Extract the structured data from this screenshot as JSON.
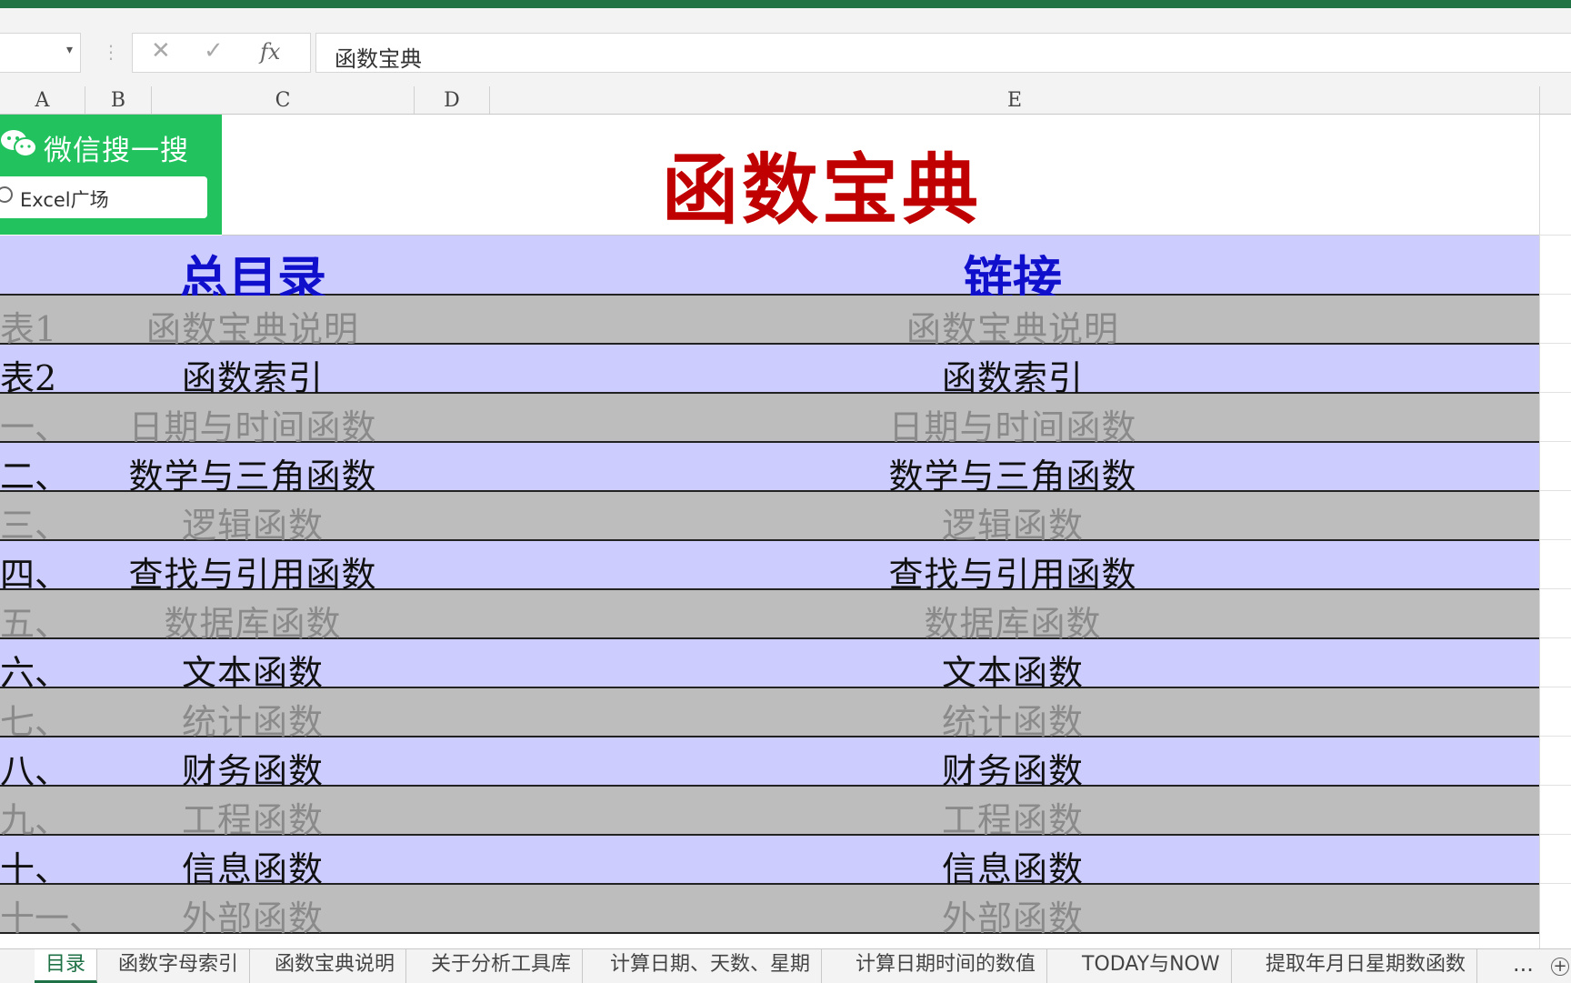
{
  "formula_bar": {
    "cancel_icon": "✕",
    "enter_icon": "✓",
    "fx_label": "fx",
    "content": "函数宝典"
  },
  "columns": [
    "A",
    "B",
    "C",
    "D",
    "E"
  ],
  "badge": {
    "title": "微信搜一搜",
    "search_text": "Excel广场",
    "color": "#22c35f"
  },
  "title": "函数宝典",
  "header": {
    "left": "总目录",
    "right": "链接"
  },
  "rows": [
    {
      "num": "表1",
      "name": "函数宝典说明",
      "link": "函数宝典说明",
      "style": "gray"
    },
    {
      "num": "表2",
      "name": "函数索引",
      "link": "函数索引",
      "style": "blue"
    },
    {
      "num": "一、",
      "name": "日期与时间函数",
      "link": "日期与时间函数",
      "style": "gray"
    },
    {
      "num": "二、",
      "name": "数学与三角函数",
      "link": "数学与三角函数",
      "style": "blue"
    },
    {
      "num": "三、",
      "name": "逻辑函数",
      "link": "逻辑函数",
      "style": "gray"
    },
    {
      "num": "四、",
      "name": "查找与引用函数",
      "link": "查找与引用函数",
      "style": "blue"
    },
    {
      "num": "五、",
      "name": "数据库函数",
      "link": "数据库函数",
      "style": "gray"
    },
    {
      "num": "六、",
      "name": "文本函数",
      "link": "文本函数",
      "style": "blue"
    },
    {
      "num": "七、",
      "name": "统计函数",
      "link": "统计函数",
      "style": "gray"
    },
    {
      "num": "八、",
      "name": "财务函数",
      "link": "财务函数",
      "style": "blue"
    },
    {
      "num": "九、",
      "name": "工程函数",
      "link": "工程函数",
      "style": "gray"
    },
    {
      "num": "十、",
      "name": "信息函数",
      "link": "信息函数",
      "style": "blue"
    },
    {
      "num": "十一、",
      "name": "外部函数",
      "link": "外部函数",
      "style": "gray"
    }
  ],
  "tabs": [
    {
      "label": "目录",
      "active": true
    },
    {
      "label": "函数字母索引"
    },
    {
      "label": "函数宝典说明"
    },
    {
      "label": "关于分析工具库"
    },
    {
      "label": "计算日期、天数、星期"
    },
    {
      "label": "计算日期时间的数值"
    },
    {
      "label": "TODAY与NOW"
    },
    {
      "label": "提取年月日星期数函数"
    }
  ],
  "tab_more": "...",
  "tab_add": "+",
  "colors": {
    "accent_green": "#217346",
    "title_red": "#c00000",
    "header_blue_text": "#1010cc",
    "row_blue": "#ccccff",
    "row_gray": "#bdbdbd"
  }
}
